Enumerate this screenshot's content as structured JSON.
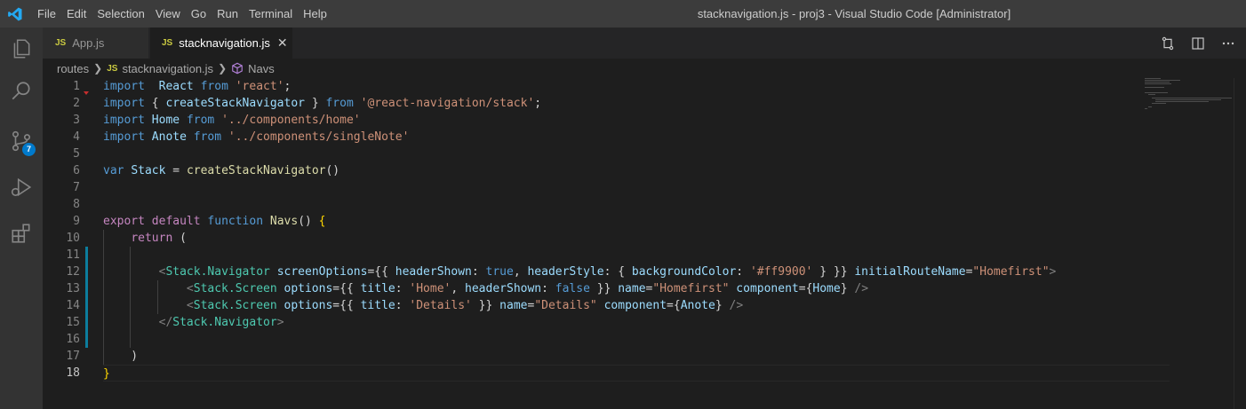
{
  "window": {
    "title": "stacknavigation.js - proj3 - Visual Studio Code [Administrator]"
  },
  "menu": [
    "File",
    "Edit",
    "Selection",
    "View",
    "Go",
    "Run",
    "Terminal",
    "Help"
  ],
  "activity": {
    "icons": [
      "explorer-icon",
      "search-icon",
      "source-control-icon",
      "run-debug-icon",
      "extensions-icon"
    ],
    "scm_badge": "7"
  },
  "tabs": [
    {
      "badge": "JS",
      "label": "App.js",
      "active": false
    },
    {
      "badge": "JS",
      "label": "stacknavigation.js",
      "active": true,
      "close": "✕"
    }
  ],
  "breadcrumbs": {
    "folder": "routes",
    "file_badge": "JS",
    "file": "stacknavigation.js",
    "symbol": "Navs"
  },
  "editor": {
    "line_numbers": [
      "1",
      "2",
      "3",
      "4",
      "5",
      "6",
      "7",
      "8",
      "9",
      "10",
      "11",
      "12",
      "13",
      "14",
      "15",
      "16",
      "17",
      "18"
    ],
    "active_line": "18",
    "lines": [
      [
        [
          "kw",
          "import"
        ],
        [
          "",
          "  "
        ],
        [
          "id",
          "React"
        ],
        [
          "",
          " "
        ],
        [
          "kw",
          "from"
        ],
        [
          "",
          " "
        ],
        [
          "str",
          "'react'"
        ],
        [
          "",
          ";"
        ]
      ],
      [
        [
          "kw",
          "import"
        ],
        [
          "",
          " { "
        ],
        [
          "id",
          "createStackNavigator"
        ],
        [
          "",
          " } "
        ],
        [
          "kw",
          "from"
        ],
        [
          "",
          " "
        ],
        [
          "str",
          "'@react-navigation/stack'"
        ],
        [
          "",
          ";"
        ]
      ],
      [
        [
          "kw",
          "import"
        ],
        [
          "",
          " "
        ],
        [
          "id",
          "Home"
        ],
        [
          "",
          " "
        ],
        [
          "kw",
          "from"
        ],
        [
          "",
          " "
        ],
        [
          "str",
          "'../components/home'"
        ]
      ],
      [
        [
          "kw",
          "import"
        ],
        [
          "",
          " "
        ],
        [
          "id",
          "Anote"
        ],
        [
          "",
          " "
        ],
        [
          "kw",
          "from"
        ],
        [
          "",
          " "
        ],
        [
          "str",
          "'../components/singleNote'"
        ]
      ],
      [],
      [
        [
          "kw",
          "var"
        ],
        [
          "",
          " "
        ],
        [
          "id",
          "Stack"
        ],
        [
          "",
          " = "
        ],
        [
          "fn",
          "createStackNavigator"
        ],
        [
          "",
          "()"
        ]
      ],
      [],
      [],
      [
        [
          "ctl",
          "export"
        ],
        [
          "",
          " "
        ],
        [
          "ctl",
          "default"
        ],
        [
          "",
          " "
        ],
        [
          "kw",
          "function"
        ],
        [
          "",
          " "
        ],
        [
          "fn",
          "Navs"
        ],
        [
          "",
          "() "
        ],
        [
          "br",
          "{"
        ]
      ],
      [
        [
          "",
          "    "
        ],
        [
          "ctl",
          "return"
        ],
        [
          "",
          " ("
        ]
      ],
      [],
      [
        [
          "",
          "        "
        ],
        [
          "pun",
          "<"
        ],
        [
          "tag",
          "Stack.Navigator"
        ],
        [
          "",
          " "
        ],
        [
          "id",
          "screenOptions"
        ],
        [
          "",
          "={{ "
        ],
        [
          "id",
          "headerShown"
        ],
        [
          "",
          ": "
        ],
        [
          "kw",
          "true"
        ],
        [
          "",
          ", "
        ],
        [
          "id",
          "headerStyle"
        ],
        [
          "",
          ": { "
        ],
        [
          "id",
          "backgroundColor"
        ],
        [
          "",
          ": "
        ],
        [
          "str",
          "'#ff9900'"
        ],
        [
          "",
          " } }} "
        ],
        [
          "id",
          "initialRouteName"
        ],
        [
          "",
          "="
        ],
        [
          "str",
          "\"Homefirst\""
        ],
        [
          "pun",
          ">"
        ]
      ],
      [
        [
          "",
          "            "
        ],
        [
          "pun",
          "<"
        ],
        [
          "tag",
          "Stack.Screen"
        ],
        [
          "",
          " "
        ],
        [
          "id",
          "options"
        ],
        [
          "",
          "={{ "
        ],
        [
          "id",
          "title"
        ],
        [
          "",
          ": "
        ],
        [
          "str",
          "'Home'"
        ],
        [
          "",
          ", "
        ],
        [
          "id",
          "headerShown"
        ],
        [
          "",
          ": "
        ],
        [
          "kw",
          "false"
        ],
        [
          "",
          " }} "
        ],
        [
          "id",
          "name"
        ],
        [
          "",
          "="
        ],
        [
          "str",
          "\"Homefirst\""
        ],
        [
          "",
          " "
        ],
        [
          "id",
          "component"
        ],
        [
          "",
          "={"
        ],
        [
          "id",
          "Home"
        ],
        [
          "",
          "} "
        ],
        [
          "pun",
          "/>"
        ]
      ],
      [
        [
          "",
          "            "
        ],
        [
          "pun",
          "<"
        ],
        [
          "tag",
          "Stack.Screen"
        ],
        [
          "",
          " "
        ],
        [
          "id",
          "options"
        ],
        [
          "",
          "={{ "
        ],
        [
          "id",
          "title"
        ],
        [
          "",
          ": "
        ],
        [
          "str",
          "'Details'"
        ],
        [
          "",
          " }} "
        ],
        [
          "id",
          "name"
        ],
        [
          "",
          "="
        ],
        [
          "str",
          "\"Details\""
        ],
        [
          "",
          " "
        ],
        [
          "id",
          "component"
        ],
        [
          "",
          "={"
        ],
        [
          "id",
          "Anote"
        ],
        [
          "",
          "} "
        ],
        [
          "pun",
          "/>"
        ]
      ],
      [
        [
          "",
          "        "
        ],
        [
          "pun",
          "</"
        ],
        [
          "tag",
          "Stack.Navigator"
        ],
        [
          "pun",
          ">"
        ]
      ],
      [],
      [
        [
          "",
          "    )"
        ]
      ],
      [
        [
          "br",
          "}"
        ]
      ]
    ]
  },
  "colors": {
    "titlebar": "#3c3c3c",
    "activitybar": "#333333",
    "editor_bg": "#1e1e1e",
    "accent": "#007acc"
  }
}
